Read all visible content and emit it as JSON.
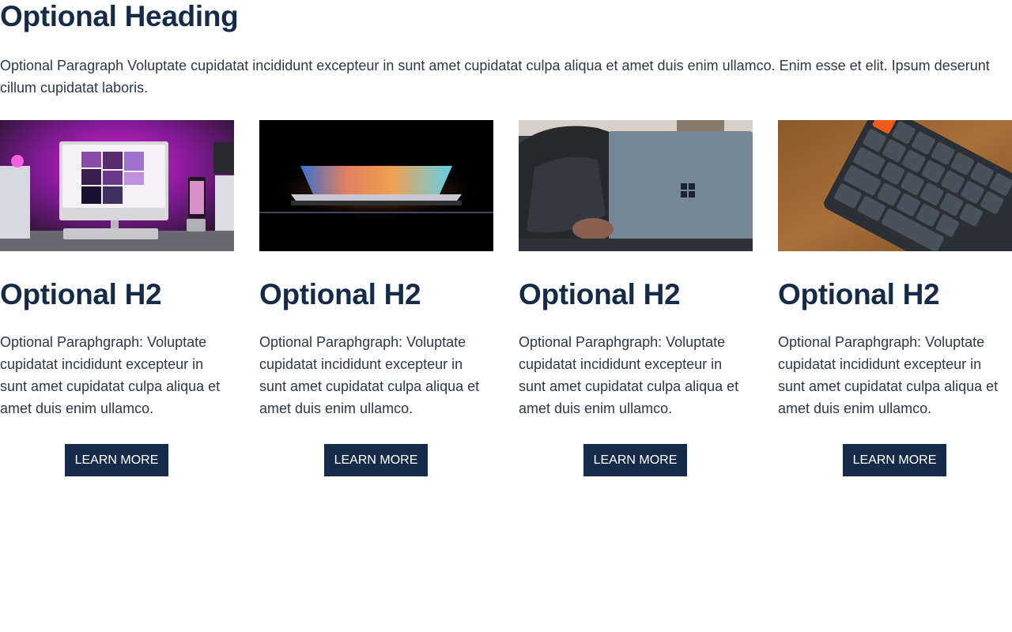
{
  "heading": "Optional Heading",
  "intro": "Optional Paragraph Voluptate cupidatat incididunt excepteur in sunt amet cupidatat culpa aliqua et amet duis enim ullamco. Enim esse et elit. Ipsum deserunt cillum cupidatat laboris.",
  "colors": {
    "heading": "#162b49",
    "text": "#2d3748",
    "button_bg": "#162b49",
    "button_text": "#ffffff"
  },
  "cards": [
    {
      "image": "desktop-setup-photo",
      "title": "Optional H2",
      "text": "Optional Paraphgraph: Voluptate cupidatat incididunt excepteur in sunt amet cupidatat culpa aliqua et amet duis enim ullamco.",
      "button": "Learn more"
    },
    {
      "image": "glowing-laptop-photo",
      "title": "Optional H2",
      "text": "Optional Paraphgraph: Voluptate cupidatat incididunt excepteur in sunt amet cupidatat culpa aliqua et amet duis enim ullamco.",
      "button": "Learn more"
    },
    {
      "image": "surface-laptop-photo",
      "title": "Optional H2",
      "text": "Optional Paraphgraph: Voluptate cupidatat incididunt excepteur in sunt amet cupidatat culpa aliqua et amet duis enim ullamco.",
      "button": "Learn more"
    },
    {
      "image": "keyboard-photo",
      "title": "Optional H2",
      "text": "Optional Paraphgraph: Voluptate cupidatat incididunt excepteur in sunt amet cupidatat culpa aliqua et amet duis enim ullamco.",
      "button": "Learn more"
    }
  ]
}
